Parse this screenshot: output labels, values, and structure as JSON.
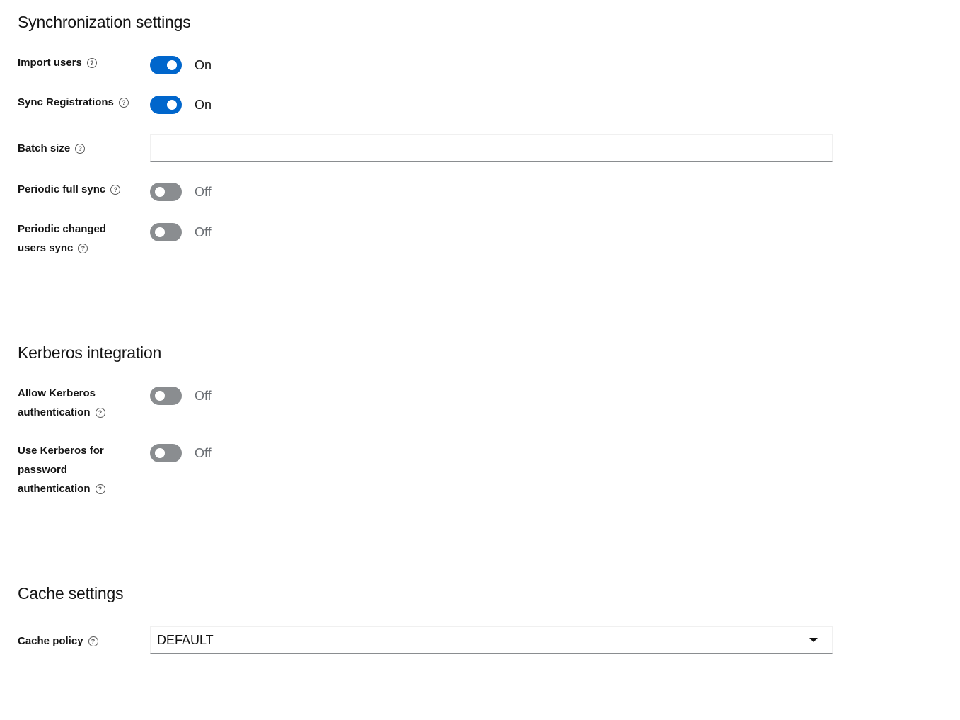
{
  "sync": {
    "title": "Synchronization settings",
    "import_users": {
      "label": "Import users",
      "state": "On"
    },
    "sync_registrations": {
      "label": "Sync Registrations",
      "state": "On"
    },
    "batch_size": {
      "label": "Batch size",
      "value": ""
    },
    "periodic_full_sync": {
      "label": "Periodic full sync",
      "state": "Off"
    },
    "periodic_changed": {
      "label_line1": "Periodic changed",
      "label_line2": "users sync",
      "state": "Off"
    }
  },
  "kerberos": {
    "title": "Kerberos integration",
    "allow_auth": {
      "label_line1": "Allow Kerberos",
      "label_line2": "authentication",
      "state": "Off"
    },
    "use_for_password": {
      "label_line1": "Use Kerberos for",
      "label_line2": "password",
      "label_line3": "authentication",
      "state": "Off"
    }
  },
  "cache": {
    "title": "Cache settings",
    "policy": {
      "label": "Cache policy",
      "value": "DEFAULT"
    }
  },
  "icons": {
    "help": "?"
  },
  "colors": {
    "accent": "#0066cc",
    "switch_off": "#8a8d90",
    "text": "#151515",
    "muted_text": "#6a6e73"
  }
}
